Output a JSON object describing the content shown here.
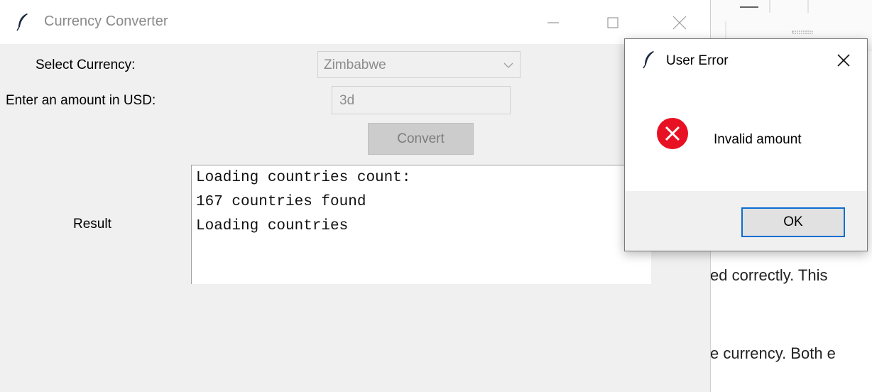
{
  "main_window": {
    "title": "Currency Converter",
    "icon": "feather-icon",
    "controls": {
      "minimize": "minimize-icon",
      "maximize": "maximize-icon",
      "close": "close-icon"
    }
  },
  "form": {
    "select_label": "Select Currency:",
    "currency_value": "Zimbabwe",
    "amount_label": "Enter an amount in USD:",
    "amount_value": "3d",
    "convert_label": "Convert",
    "result_label": "Result",
    "result_lines": [
      "Loading countries count:",
      "167 countries found",
      "Loading countries"
    ]
  },
  "dialog": {
    "title": "User Error",
    "icon": "feather-icon",
    "message_icon": "error-icon",
    "message": "Invalid amount",
    "ok_label": "OK",
    "accent": "#0a6ed1",
    "error_color": "#e81123"
  },
  "background_doc": {
    "line1": "ed correctly. This",
    "line2": "e currency. Both e"
  }
}
